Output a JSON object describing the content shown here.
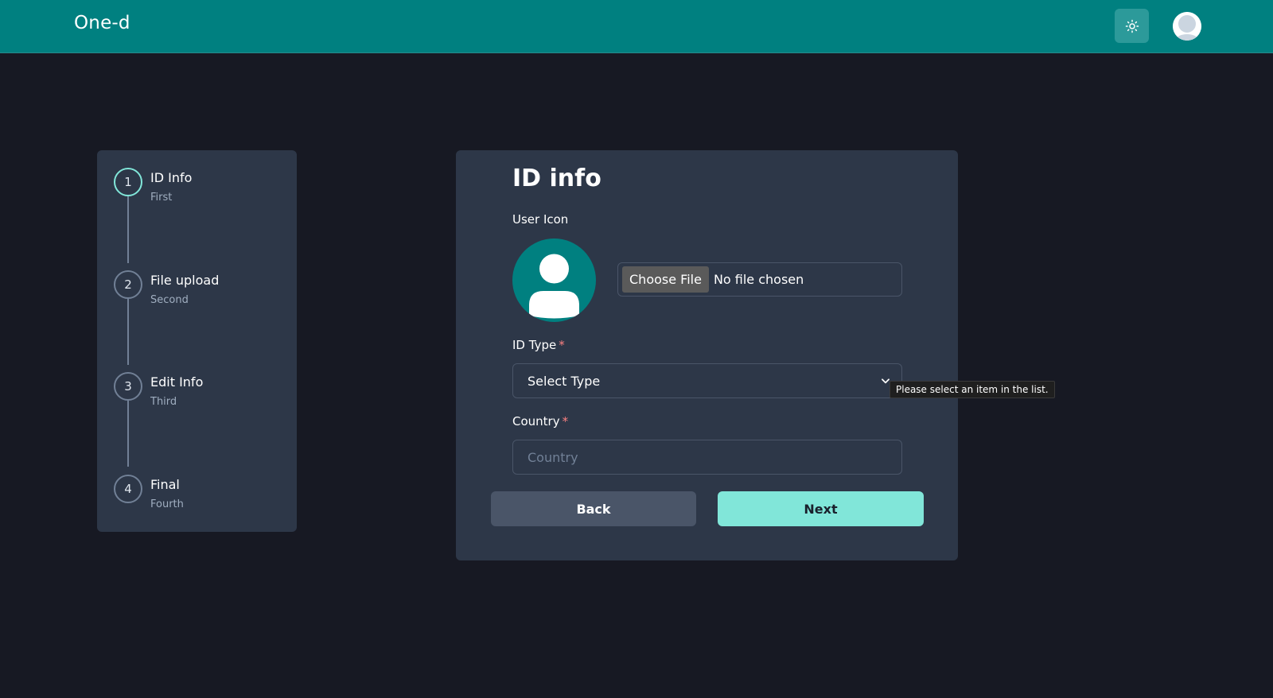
{
  "header": {
    "brand": "One-d",
    "theme_toggle_icon": "sun-icon",
    "avatar_icon": "user-avatar-icon"
  },
  "stepper": {
    "steps": [
      {
        "number": "1",
        "title": "ID Info",
        "subtitle": "First",
        "active": true
      },
      {
        "number": "2",
        "title": "File upload",
        "subtitle": "Second",
        "active": false
      },
      {
        "number": "3",
        "title": "Edit Info",
        "subtitle": "Third",
        "active": false
      },
      {
        "number": "4",
        "title": "Final",
        "subtitle": "Fourth",
        "active": false
      }
    ]
  },
  "form": {
    "title": "ID info",
    "user_icon_label": "User Icon",
    "file_button": "Choose File",
    "file_status": "No file chosen",
    "id_type_label": "ID Type",
    "required_mark": "*",
    "id_type_value": "Select Type",
    "country_label": "Country",
    "country_placeholder": "Country",
    "country_value": "",
    "back_label": "Back",
    "next_label": "Next"
  },
  "tooltip": {
    "text": "Please select an item in the list."
  },
  "colors": {
    "header_bg": "#008080",
    "page_bg": "#171923",
    "panel_bg": "#2d3748",
    "accent": "#81e6d9",
    "required": "#fc8181"
  }
}
